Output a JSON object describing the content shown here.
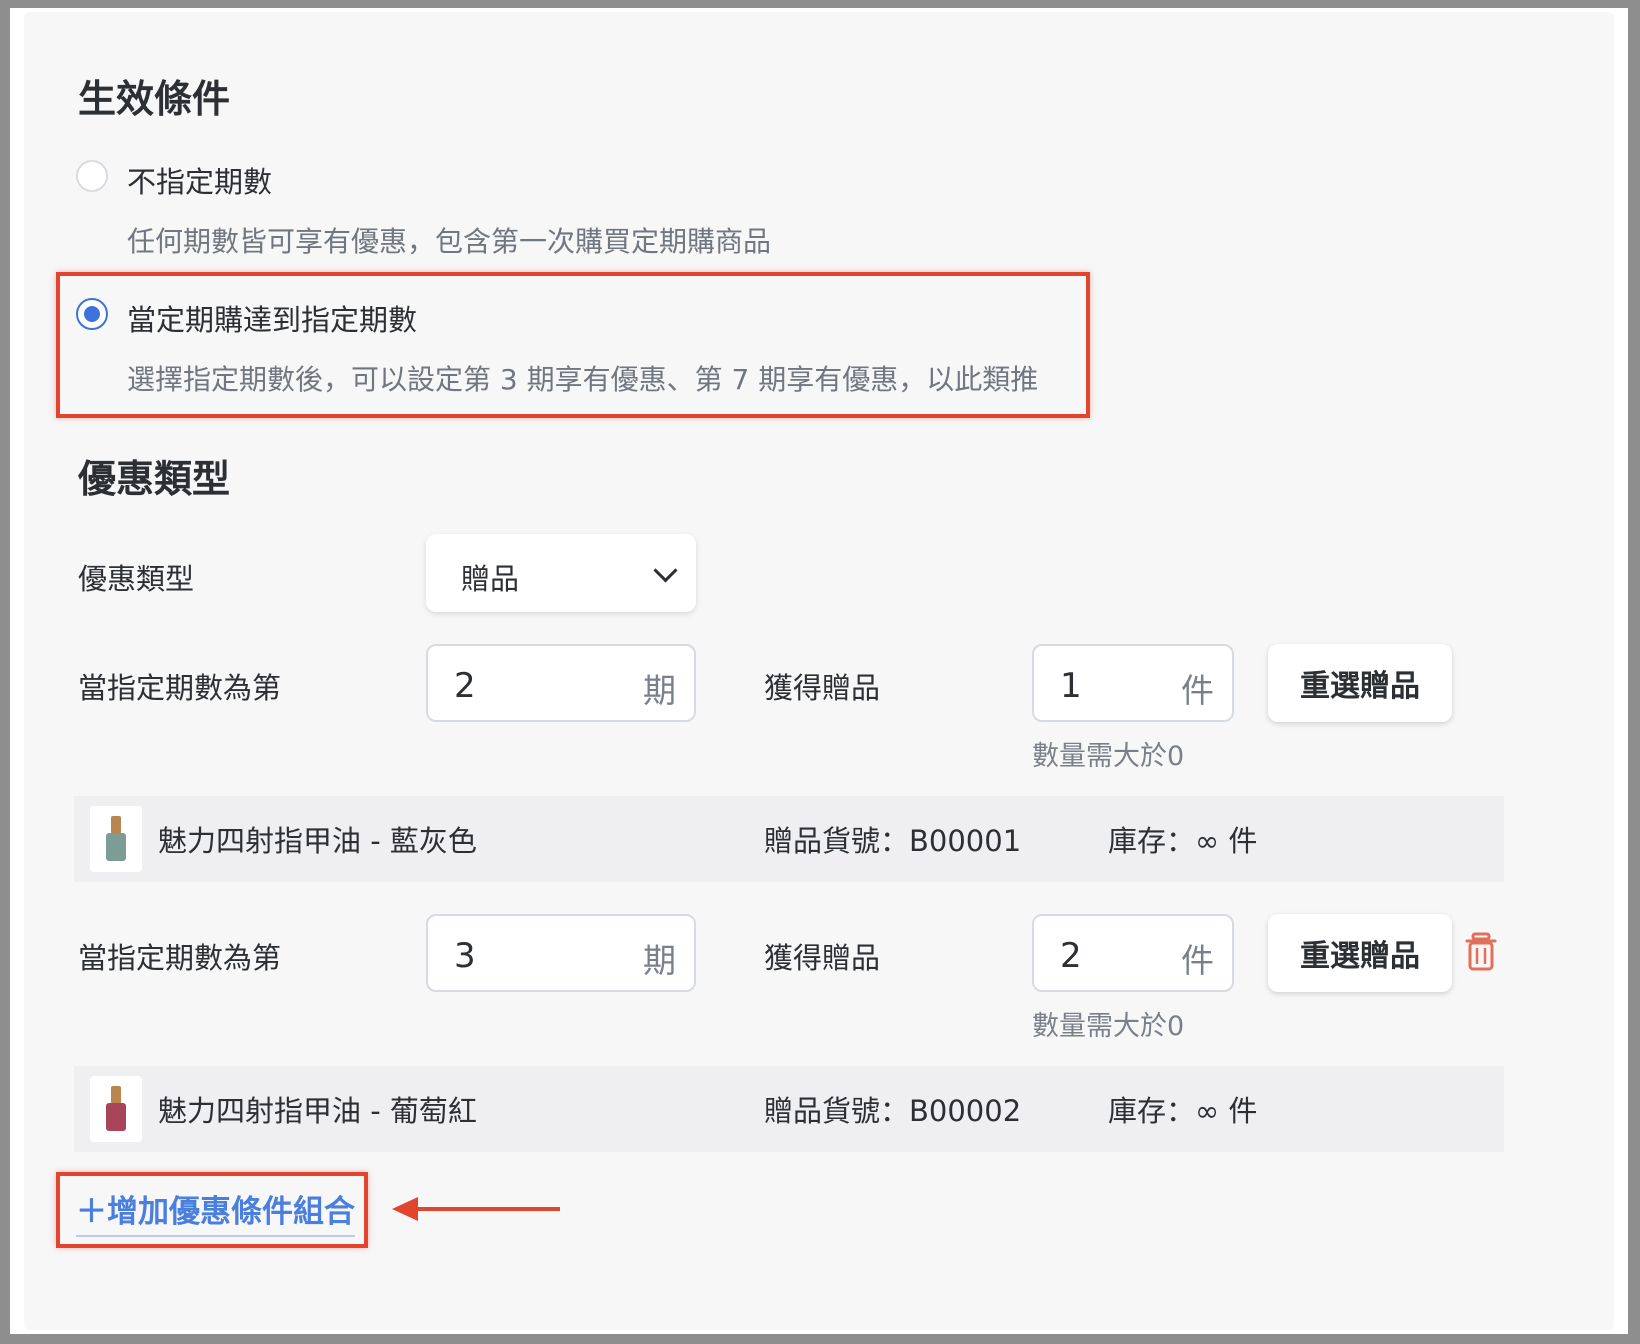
{
  "effective_conditions": {
    "title": "生效條件",
    "options": [
      {
        "label": "不指定期數",
        "description": "任何期數皆可享有優惠，包含第一次購買定期購商品",
        "selected": false
      },
      {
        "label": "當定期購達到指定期數",
        "description": "選擇指定期數後，可以設定第 3 期享有優惠、第 7 期享有優惠，以此類推",
        "selected": true
      }
    ]
  },
  "discount_type": {
    "title": "優惠類型",
    "field_label": "優惠類型",
    "selected_value": "贈品"
  },
  "rules": [
    {
      "period_label": "當指定期數為第",
      "period_value": "2",
      "period_unit": "期",
      "gift_label": "獲得贈品",
      "gift_qty": "1",
      "gift_unit": "件",
      "hint": "數量需大於0",
      "reselect_label": "重選贈品",
      "product": {
        "name": "魅力四射指甲油 - 藍灰色",
        "sku": "贈品貨號：B00001",
        "stock": "庫存：∞ 件",
        "polish_color": "#7d9c95"
      }
    },
    {
      "period_label": "當指定期數為第",
      "period_value": "3",
      "period_unit": "期",
      "gift_label": "獲得贈品",
      "gift_qty": "2",
      "gift_unit": "件",
      "hint": "數量需大於0",
      "reselect_label": "重選贈品",
      "product": {
        "name": "魅力四射指甲油 - 葡萄紅",
        "sku": "贈品貨號：B00002",
        "stock": "庫存：∞ 件",
        "polish_color": "#a8455a"
      }
    }
  ],
  "add_condition": {
    "label": "＋增加優惠條件組合"
  },
  "colors": {
    "accent": "#3d73d9",
    "link": "#4a7fe0",
    "annotation": "#e2452e",
    "delete": "#e0705a"
  }
}
